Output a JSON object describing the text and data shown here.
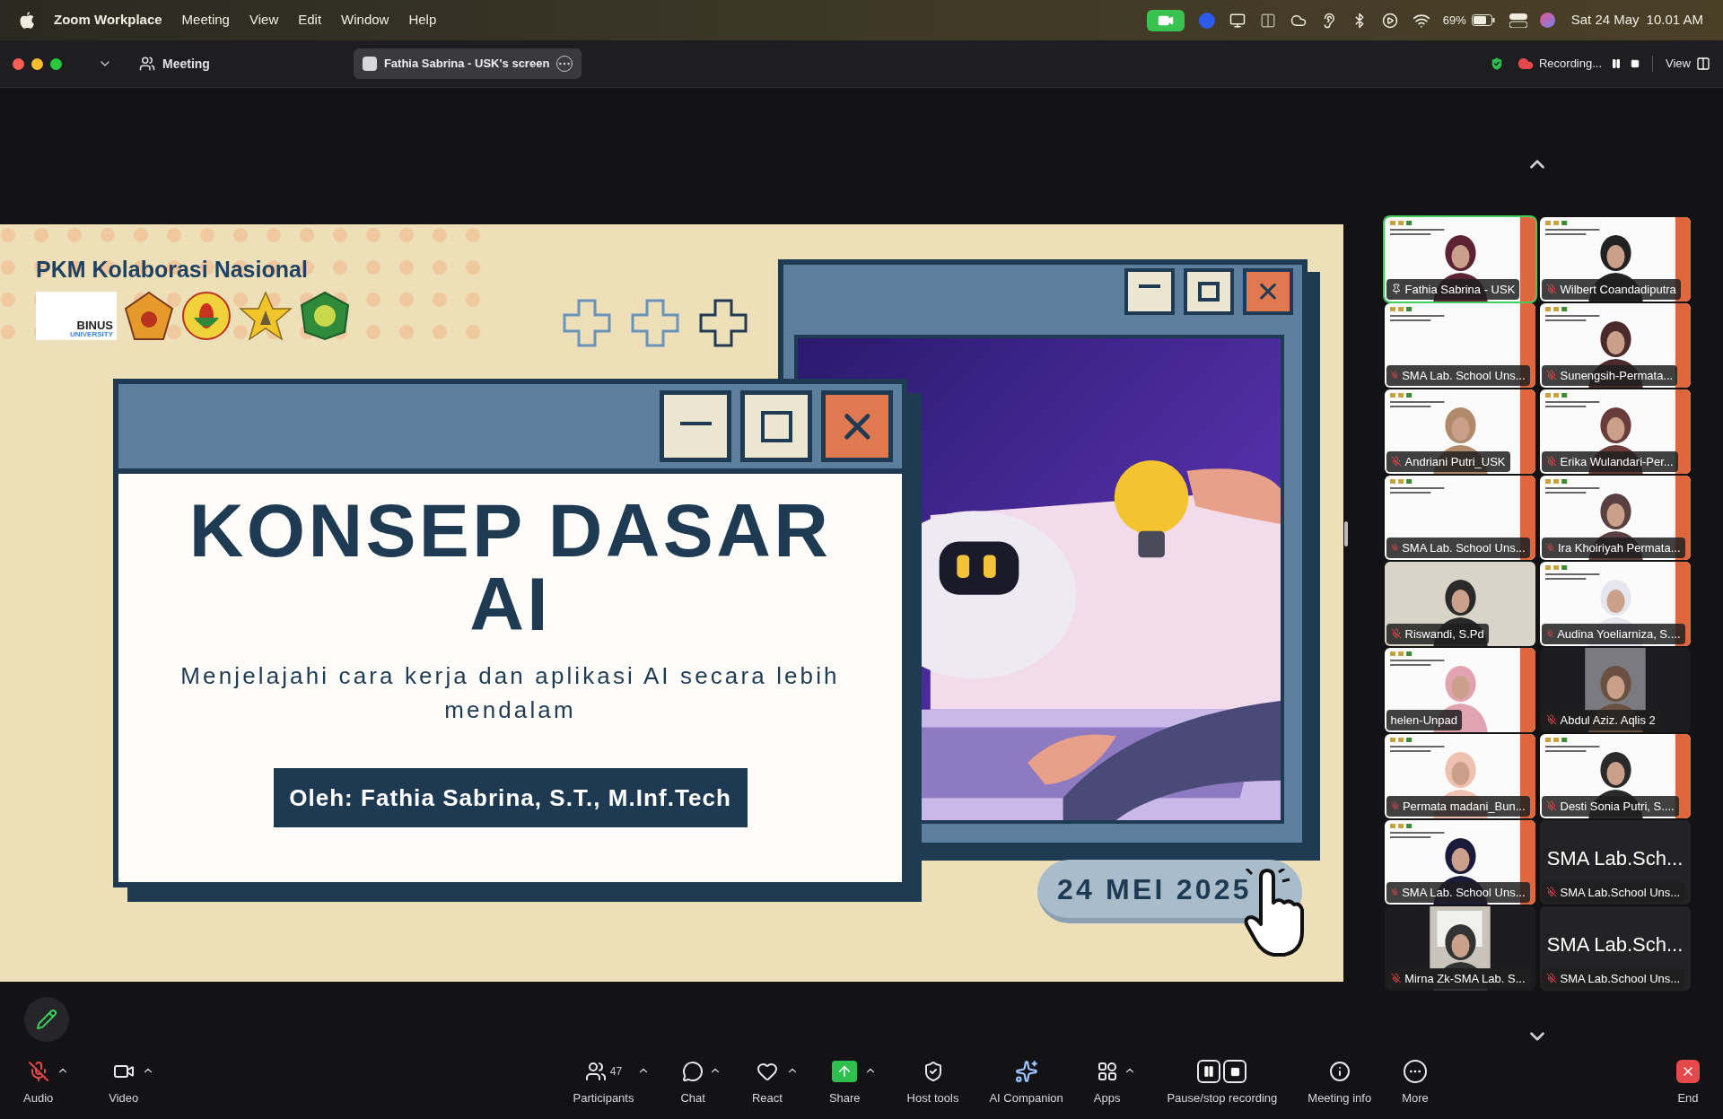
{
  "menu_bar": {
    "app_name": "Zoom Workplace",
    "menus": [
      "Meeting",
      "View",
      "Edit",
      "Window",
      "Help"
    ],
    "battery_percent": "69%",
    "date": "Sat 24 May",
    "time": "10.01 AM"
  },
  "title_bar": {
    "title": "Meeting",
    "share_label": "Fathia Sabrina - USK's screen",
    "recording_label": "Recording...",
    "view_label": "View"
  },
  "slide": {
    "header": "PKM Kolaborasi Nasional",
    "logo_name": "BINUS",
    "logo_subname": "UNIVERSITY",
    "title": "KONSEP DASAR AI",
    "subtitle": "Menjelajahi cara kerja dan aplikasi AI secara lebih mendalam",
    "presenter": "Oleh: Fathia Sabrina, S.T., M.Inf.Tech",
    "date": "24 MEI 2025"
  },
  "participants": [
    {
      "name": "Fathia Sabrina - USK",
      "kind": "video",
      "muted": false,
      "pinned": true,
      "selected": true
    },
    {
      "name": "Wilbert Coandadiputra",
      "kind": "video",
      "muted": true,
      "pinned": false,
      "selected": false
    },
    {
      "name": "SMA Lab. School Uns...",
      "kind": "video",
      "muted": true,
      "pinned": false,
      "selected": false
    },
    {
      "name": "Sunengsih-Permata...",
      "kind": "video",
      "muted": true,
      "pinned": false,
      "selected": false
    },
    {
      "name": "Andriani Putri_USK",
      "kind": "video",
      "muted": true,
      "pinned": false,
      "selected": false
    },
    {
      "name": "Erika Wulandari-Per...",
      "kind": "video",
      "muted": true,
      "pinned": false,
      "selected": false
    },
    {
      "name": "SMA Lab. School Uns...",
      "kind": "video",
      "muted": true,
      "pinned": false,
      "selected": false
    },
    {
      "name": "Ira Khoiriyah Permata...",
      "kind": "video",
      "muted": true,
      "pinned": false,
      "selected": false
    },
    {
      "name": "Riswandi, S.Pd",
      "kind": "video",
      "muted": true,
      "pinned": false,
      "selected": false
    },
    {
      "name": "Audina Yoeliarniza, S....",
      "kind": "video",
      "muted": true,
      "pinned": false,
      "selected": false
    },
    {
      "name": "helen-Unpad",
      "kind": "video",
      "muted": false,
      "pinned": false,
      "selected": false
    },
    {
      "name": "Abdul Aziz. Aqlis 2",
      "kind": "video",
      "muted": true,
      "pinned": false,
      "selected": false
    },
    {
      "name": "Permata madani_Bun...",
      "kind": "video",
      "muted": true,
      "pinned": false,
      "selected": false
    },
    {
      "name": "Desti Sonia Putri, S....",
      "kind": "video",
      "muted": true,
      "pinned": false,
      "selected": false
    },
    {
      "name": "SMA Lab. School Uns...",
      "kind": "video",
      "muted": true,
      "pinned": false,
      "selected": false
    },
    {
      "name": "SMA Lab.School Uns...",
      "kind": "name",
      "display_name": "SMA Lab.Sch...",
      "muted": true,
      "pinned": false,
      "selected": false
    },
    {
      "name": "Mirna Zk-SMA Lab. S...",
      "kind": "video",
      "muted": true,
      "pinned": false,
      "selected": false
    },
    {
      "name": "SMA Lab.School Uns...",
      "kind": "name",
      "display_name": "SMA Lab.Sch...",
      "muted": true,
      "pinned": false,
      "selected": false
    }
  ],
  "toolbar": [
    {
      "kind": "audio",
      "label": "Audio",
      "caret": true,
      "muted": true
    },
    {
      "kind": "video",
      "label": "Video",
      "caret": true
    },
    {
      "kind": "participants",
      "label": "Participants",
      "count": "47",
      "caret": true
    },
    {
      "kind": "chat",
      "label": "Chat",
      "caret": true
    },
    {
      "kind": "react",
      "label": "React",
      "caret": true
    },
    {
      "kind": "share",
      "label": "Share",
      "caret": true
    },
    {
      "kind": "host",
      "label": "Host tools",
      "caret": false
    },
    {
      "kind": "ai",
      "label": "AI Companion",
      "caret": false
    },
    {
      "kind": "apps",
      "label": "Apps",
      "caret": true
    },
    {
      "kind": "record",
      "label": "Pause/stop recording",
      "caret": false
    },
    {
      "kind": "info",
      "label": "Meeting info",
      "caret": false
    },
    {
      "kind": "more",
      "label": "More",
      "caret": false
    },
    {
      "kind": "end",
      "label": "End",
      "caret": false
    }
  ]
}
